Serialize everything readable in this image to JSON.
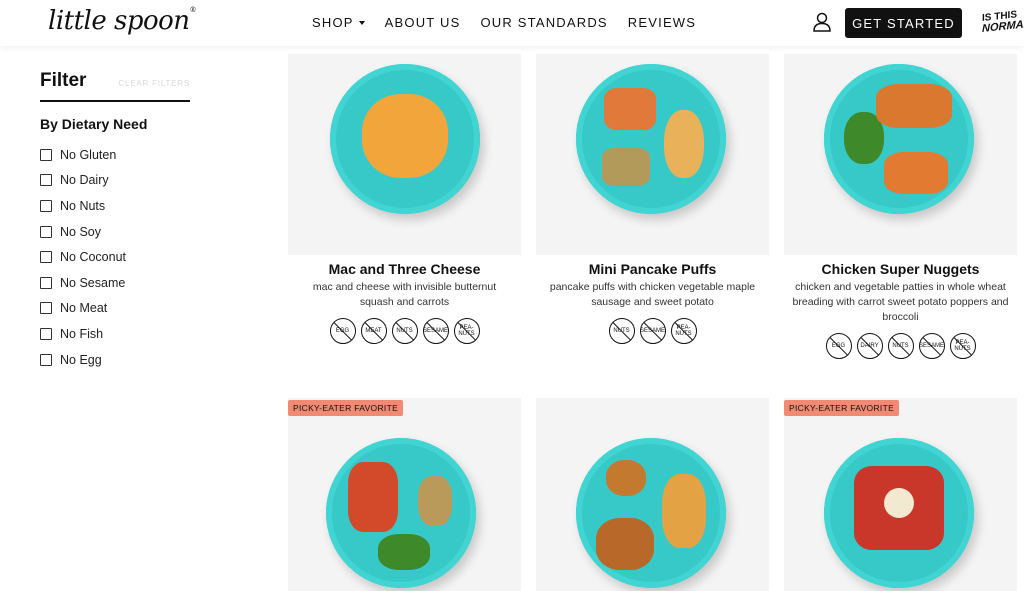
{
  "brand": {
    "logo_text": "little spoon",
    "logo_mark": "®"
  },
  "nav": {
    "items": [
      {
        "label": "SHOP",
        "has_dropdown": true
      },
      {
        "label": "ABOUT US"
      },
      {
        "label": "OUR STANDARDS"
      },
      {
        "label": "REVIEWS"
      }
    ],
    "cta_label": "GET STARTED",
    "badge_line1": "IS THIS",
    "badge_line2": "NORMAL",
    "account_icon": "user-icon"
  },
  "sidebar": {
    "title": "Filter",
    "clear_label": "CLEAR FILTERS",
    "group_title": "By Dietary Need",
    "options": [
      "No Gluten",
      "No Dairy",
      "No Nuts",
      "No Soy",
      "No Coconut",
      "No Sesame",
      "No Meat",
      "No Fish",
      "No Egg"
    ]
  },
  "products": [
    {
      "name": "Mac and Three Cheese",
      "description": "mac and cheese with invisible butternut squash and carrots",
      "allergens": [
        "EGG",
        "MEAT",
        "NUTS",
        "SESAME",
        "PEA-NUTS"
      ],
      "tag": ""
    },
    {
      "name": "Mini Pancake Puffs",
      "description": "pancake puffs with chicken vegetable maple sausage and sweet potato",
      "allergens": [
        "NUTS",
        "SESAME",
        "PEA-NUTS"
      ],
      "tag": ""
    },
    {
      "name": "Chicken Super Nuggets",
      "description": "chicken and vegetable patties in whole wheat breading with carrot sweet potato poppers and broccoli",
      "allergens": [
        "EGG",
        "DAIRY",
        "NUTS",
        "SESAME",
        "PEA-NUTS"
      ],
      "tag": ""
    },
    {
      "name": "",
      "description": "",
      "allergens": [],
      "tag": "PICKY-EATER FAVORITE"
    },
    {
      "name": "",
      "description": "",
      "allergens": [],
      "tag": ""
    },
    {
      "name": "",
      "description": "",
      "allergens": [],
      "tag": "PICKY-EATER FAVORITE"
    }
  ],
  "colors": {
    "plate": "#36c9c8",
    "tag": "#f08a73",
    "cta": "#111111"
  }
}
